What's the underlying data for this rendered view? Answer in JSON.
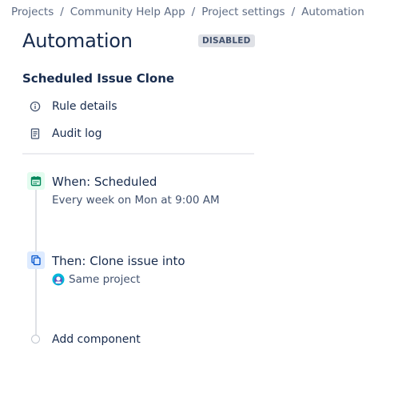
{
  "breadcrumb": {
    "items": [
      "Projects",
      "Community Help App",
      "Project settings",
      "Automation"
    ],
    "separator": "/"
  },
  "page": {
    "title": "Automation",
    "status_badge": "DISABLED"
  },
  "rule": {
    "name": "Scheduled Issue Clone",
    "nav": [
      {
        "label": "Rule details",
        "icon": "info-icon"
      },
      {
        "label": "Audit log",
        "icon": "document-icon"
      }
    ]
  },
  "components": {
    "trigger": {
      "title": "When: Scheduled",
      "subtitle": "Every week on Mon at 9:00 AM",
      "icon": "calendar-icon",
      "accent": "#00875a",
      "bg": "#e3fcef"
    },
    "action": {
      "title": "Then: Clone issue into",
      "subtitle": "Same project",
      "icon": "clone-icon",
      "subtitle_icon": "project-avatar-icon",
      "accent": "#0052cc",
      "bg": "#deebff"
    },
    "add_label": "Add component"
  },
  "colors": {
    "text_primary": "#172b4d",
    "text_secondary": "#5e6c84",
    "badge_bg": "#dfe1e6",
    "badge_text": "#42526e"
  }
}
